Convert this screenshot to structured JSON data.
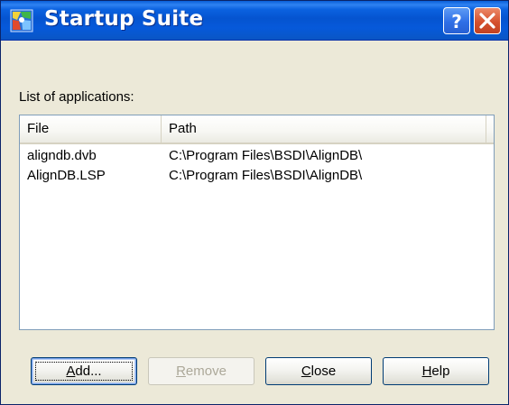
{
  "window": {
    "title": "Startup Suite",
    "help_glyph": "?",
    "close_glyph": "✕"
  },
  "list": {
    "label": "List of applications:",
    "columns": [
      "File",
      "Path"
    ],
    "rows": [
      {
        "file": "aligndb.dvb",
        "path": "C:\\Program Files\\BSDI\\AlignDB\\"
      },
      {
        "file": "AlignDB.LSP",
        "path": "C:\\Program Files\\BSDI\\AlignDB\\"
      }
    ]
  },
  "buttons": {
    "add": {
      "label": "Add...",
      "mnemonic": "A",
      "rest": "dd..."
    },
    "remove": {
      "label": "Remove",
      "mnemonic": "R",
      "rest": "emove"
    },
    "close": {
      "label": "Close",
      "mnemonic": "C",
      "rest": "lose"
    },
    "help": {
      "label": "Help",
      "mnemonic": "H",
      "rest": "elp"
    }
  },
  "colors": {
    "titlebar": "#0554d0",
    "dialog_bg": "#ece9d8",
    "close_btn": "#d6512e",
    "help_btn": "#2f6fe6"
  },
  "icons": {
    "app": "startup-suite-app-icon",
    "help": "help-icon",
    "close": "close-icon"
  }
}
